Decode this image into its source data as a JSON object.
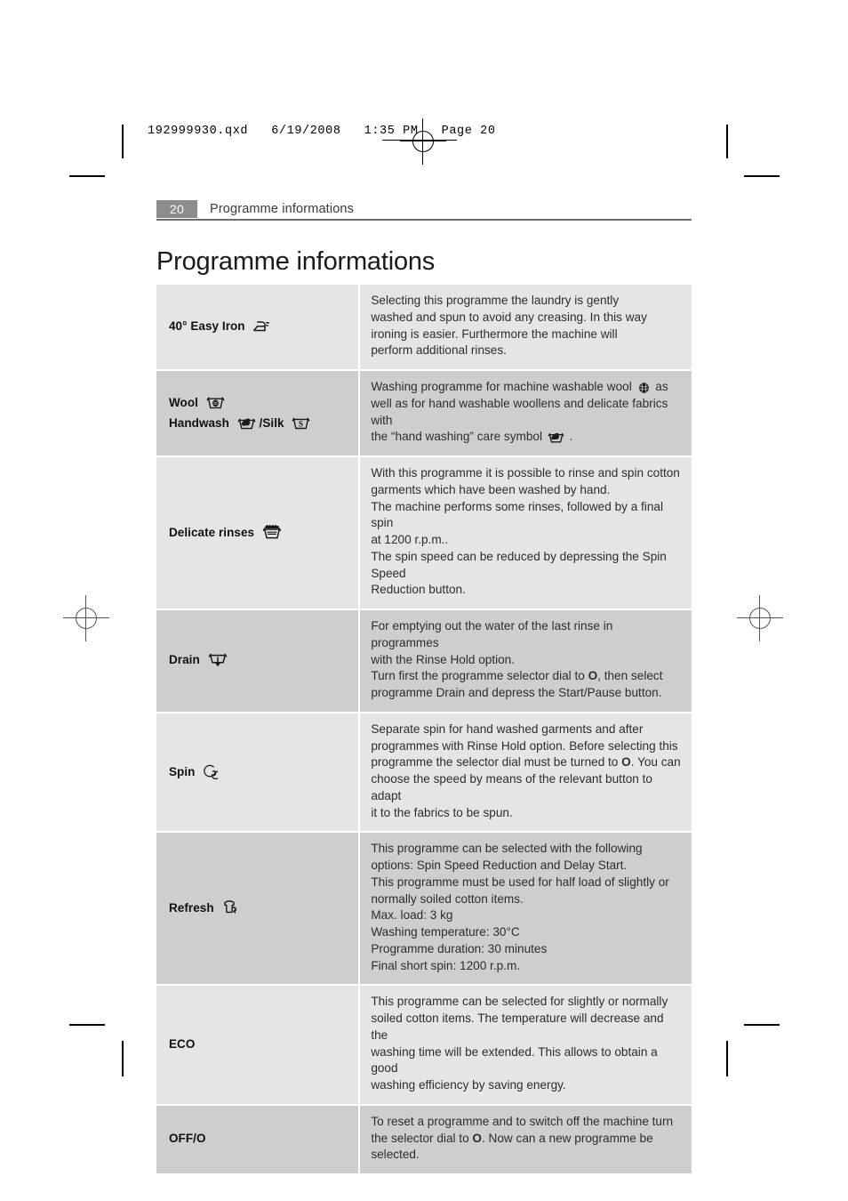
{
  "filestamp": "192999930.qxd   6/19/2008   1:35 PM   Page 20",
  "running_head": {
    "page_number": "20",
    "section": "Programme informations"
  },
  "page_title": "Programme informations",
  "colors": {
    "row_light": "#e4e5e6",
    "row_dark": "#cdced0",
    "page_number_badge": "#8c8c8c",
    "rule": "#6e6e6e",
    "body_text": "#2d2d2d"
  },
  "table": {
    "rows": [
      {
        "name": "40° Easy Iron",
        "icons": [
          "easy-iron-icon"
        ],
        "shade": "light",
        "lines": [
          "Selecting this programme the laundry is gently",
          "washed and spun to avoid any creasing. In this way",
          "ironing is easier. Furthermore the machine will",
          "perform additional rinses."
        ]
      },
      {
        "name": "Wool",
        "name2": "Handwash",
        "name2b": "/Silk",
        "icons": [
          "wool-tub-icon",
          "handwash-tub-icon",
          "silk-tub-icon"
        ],
        "shade": "dark",
        "lines": [
          "Washing programme for machine washable wool ● as",
          "well as for hand washable woollens and delicate fabrics with",
          "the “hand washing” care symbol ●."
        ],
        "inline_icons": [
          "wool-ball-icon",
          "hand-wash-symbol-icon"
        ]
      },
      {
        "name": "Delicate rinses",
        "icons": [
          "delicate-rinse-tub-icon"
        ],
        "shade": "light",
        "lines": [
          "With this programme it is possible to rinse and spin cotton",
          "garments which have been washed by hand.",
          "The machine performs some rinses, followed by a final spin",
          "at 1200 r.p.m..",
          "The spin speed can be reduced by depressing the Spin Speed",
          "Reduction button."
        ]
      },
      {
        "name": "Drain",
        "icons": [
          "drain-icon"
        ],
        "shade": "dark",
        "lines": [
          "For emptying out the water of the last rinse in programmes",
          "with the Rinse Hold option.",
          "Turn first the programme selector dial to O, then select",
          "programme Drain and depress the Start/Pause button."
        ]
      },
      {
        "name": "Spin",
        "icons": [
          "spin-icon"
        ],
        "shade": "light",
        "lines": [
          "Separate spin for hand washed garments and after",
          "programmes with Rinse Hold option. Before selecting this",
          "programme the selector dial must be turned to O. You can",
          "choose the speed by means of the relevant button to adapt",
          "it to the fabrics to be spun."
        ]
      },
      {
        "name": "Refresh",
        "icons": [
          "refresh-shirt-icon"
        ],
        "shade": "dark",
        "lines": [
          "This programme can be selected with the following",
          "options: Spin Speed Reduction and Delay Start.",
          "This programme must be used for half load of slightly or",
          "normally soiled cotton items.",
          "Max. load: 3 kg",
          "Washing temperature: 30°C",
          "Programme duration: 30 minutes",
          "Final short spin: 1200 r.p.m."
        ]
      },
      {
        "name": "ECO",
        "icons": [],
        "shade": "light",
        "lines": [
          "This programme can be selected for slightly or normally",
          "soiled cotton items. The temperature will decrease and the",
          "washing time will be extended. This allows to obtain a good",
          "washing efficiency by saving energy."
        ]
      },
      {
        "name": "OFF/O",
        "icons": [],
        "shade": "dark",
        "lines": [
          "To reset a programme and to switch off the machine turn",
          "the selector dial to O. Now can a new programme be",
          "selected."
        ]
      }
    ]
  },
  "row_text": {
    "r0": {
      "name": "40° Easy Iron",
      "l0": "Selecting this programme the laundry is gently",
      "l1": "washed and spun to avoid any creasing. In this way",
      "l2": "ironing is easier. Furthermore the machine will",
      "l3": "perform additional rinses."
    },
    "r1": {
      "name": "Wool",
      "name2": "Handwash",
      "name2b": "/Silk",
      "l0a": "Washing programme for machine washable wool",
      "l0b": "as",
      "l1": "well as for hand washable woollens and delicate fabrics with",
      "l2a": "the “hand washing” care symbol",
      "l2b": "."
    },
    "r2": {
      "name": "Delicate rinses",
      "l0": "With this programme it is possible to rinse and spin cotton",
      "l1": "garments which have been washed by hand.",
      "l2": "The machine performs some rinses, followed by a final spin",
      "l3": "at 1200 r.p.m..",
      "l4": "The spin speed can be reduced by depressing the Spin Speed",
      "l5": "Reduction button."
    },
    "r3": {
      "name": "Drain",
      "l0": "For emptying out the water of the last rinse in programmes",
      "l1": "with the Rinse Hold option.",
      "l2a": "Turn first the programme selector dial to ",
      "l2b": "O",
      "l2c": ", then select",
      "l3": "programme Drain and depress the Start/Pause button."
    },
    "r4": {
      "name": "Spin",
      "l0": "Separate spin for hand washed garments and after",
      "l1": "programmes with Rinse Hold option. Before selecting this",
      "l2a": "programme the selector dial must be turned to ",
      "l2b": "O",
      "l2c": ". You can",
      "l3": "choose the speed by means of the relevant button to adapt",
      "l4": "it to the fabrics to be spun."
    },
    "r5": {
      "name": "Refresh",
      "l0": "This programme can be selected with the following",
      "l1": "options: Spin Speed Reduction and Delay Start.",
      "l2": "This programme must be used for half load of slightly or",
      "l3": "normally soiled cotton items.",
      "l4": "Max. load: 3 kg",
      "l5": "Washing temperature: 30°C",
      "l6": "Programme duration: 30 minutes",
      "l7": "Final short spin: 1200 r.p.m."
    },
    "r6": {
      "name": "ECO",
      "l0": "This programme can be selected for slightly or normally",
      "l1": "soiled cotton items. The temperature will decrease and the",
      "l2": "washing time will be extended. This allows to obtain a good",
      "l3": "washing efficiency by saving energy."
    },
    "r7": {
      "name": "OFF/O",
      "l0": "To reset a programme and to switch off the machine turn",
      "l1a": "the selector dial to ",
      "l1b": "O",
      "l1c": ". Now can a new programme be",
      "l2": "selected."
    }
  }
}
